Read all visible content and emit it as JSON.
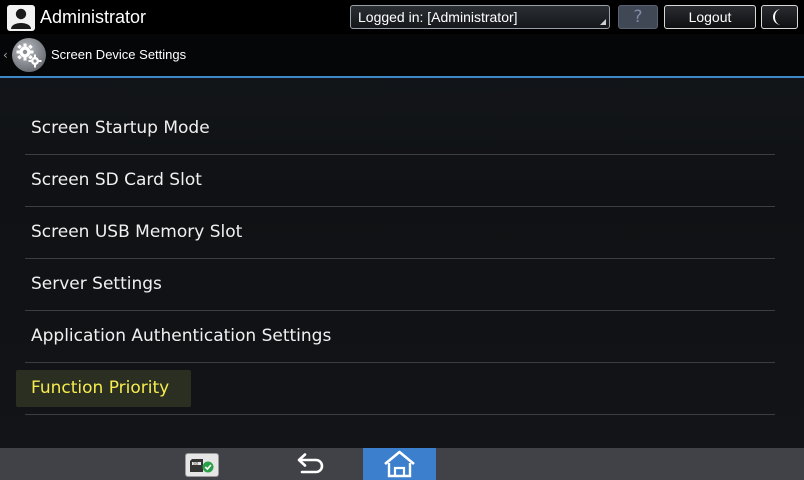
{
  "topbar": {
    "user_name": "Administrator",
    "login_status": "Logged in: [Administrator]",
    "help_label": "?",
    "logout_label": "Logout",
    "icons": {
      "user": "user-silhouette-icon",
      "energy": "crescent-moon-icon"
    }
  },
  "header": {
    "title": "Screen Device Settings",
    "back_label": "‹",
    "icon": "gear-icon"
  },
  "settings": {
    "items": [
      {
        "label": "Screen Startup Mode",
        "selected": false
      },
      {
        "label": "Screen SD Card Slot",
        "selected": false
      },
      {
        "label": "Screen USB Memory Slot",
        "selected": false
      },
      {
        "label": "Server Settings",
        "selected": false
      },
      {
        "label": "Application Authentication Settings",
        "selected": false
      },
      {
        "label": "Function Priority",
        "selected": true
      }
    ]
  },
  "bottombar": {
    "icons": {
      "sd": "sd-card-check-icon",
      "back": "back-arrow-icon",
      "home": "home-icon"
    }
  },
  "colors": {
    "accent": "#3e87c7",
    "selected_text": "#f6ec4f",
    "home_button": "#3c7fcc"
  }
}
